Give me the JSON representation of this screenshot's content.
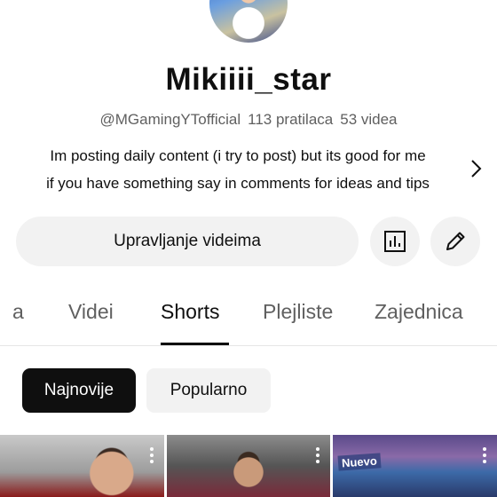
{
  "channel": {
    "name": "Mikiiii_star",
    "handle": "@MGamingYTofficial",
    "subscribers": "113 pratilaca",
    "videos": "53 videa",
    "description_line1": "Im posting daily content (i try to post) but its good for me",
    "description_line2": "if you have something say in comments for ideas and tips"
  },
  "actions": {
    "manage_label": "Upravljanje videima",
    "analytics_icon": "analytics-icon",
    "edit_icon": "pencil-icon"
  },
  "tabs": [
    {
      "label": "a"
    },
    {
      "label": "Videi"
    },
    {
      "label": "Shorts",
      "active": true
    },
    {
      "label": "Plejliste"
    },
    {
      "label": "Zajednica"
    }
  ],
  "chips": {
    "newest": "Najnovije",
    "popular": "Popularno"
  },
  "thumbnails": [
    {
      "overlay": ""
    },
    {
      "overlay": ""
    },
    {
      "overlay": "Nuevo"
    }
  ],
  "colors": {
    "text_primary": "#0f0f0f",
    "text_secondary": "#606060",
    "chip_bg": "#f2f2f2",
    "chip_active_bg": "#0f0f0f"
  }
}
